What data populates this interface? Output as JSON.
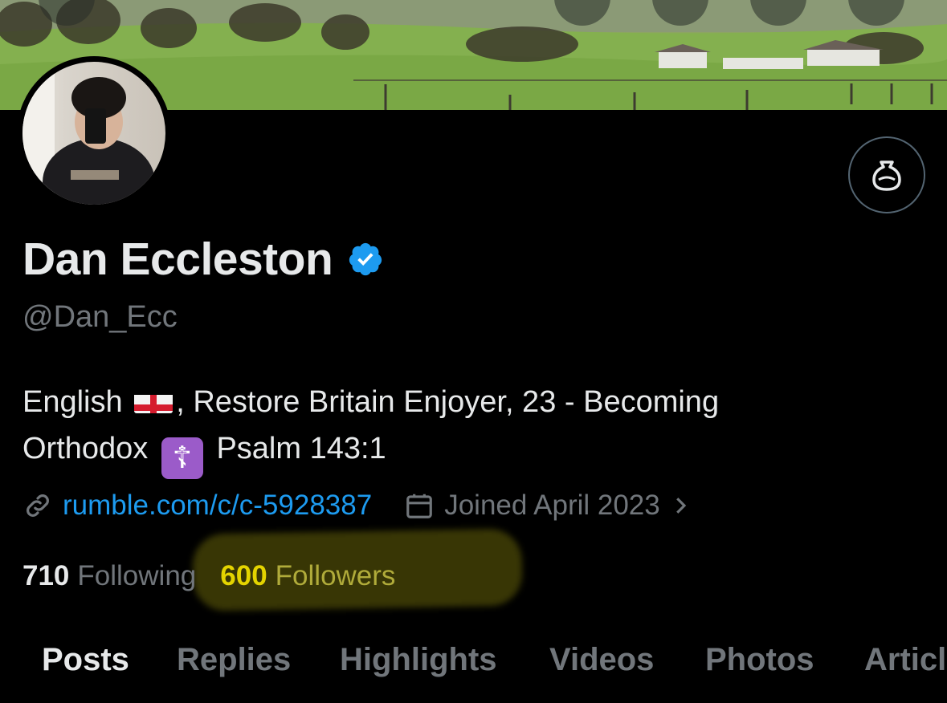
{
  "profile": {
    "name": "Dan Eccleston",
    "handle": "@Dan_Ecc",
    "bio_part1": ", Restore Britain Enjoyer, 23 - Becoming",
    "bio_lead": "English",
    "bio_line2_start": "Orthodox",
    "bio_line2_end": "Psalm 143:1",
    "link": "rumble.com/c/c-5928387",
    "joined": "Joined April 2023",
    "following_count": "710",
    "following_label": "Following",
    "followers_count": "600",
    "followers_label": "Followers"
  },
  "tabs": [
    "Posts",
    "Replies",
    "Highlights",
    "Videos",
    "Photos",
    "Articl"
  ],
  "icons": {
    "verified": "verified-badge-icon",
    "grok": "grok-icon",
    "link": "link-icon",
    "calendar": "calendar-icon",
    "chevron": "chevron-right-icon",
    "flag": "england-flag-icon",
    "cross": "orthodox-cross-icon"
  },
  "colors": {
    "accent": "#1d9bf0",
    "highlight": "#e4d400",
    "muted": "#71767b",
    "text": "#e7e9ea"
  }
}
